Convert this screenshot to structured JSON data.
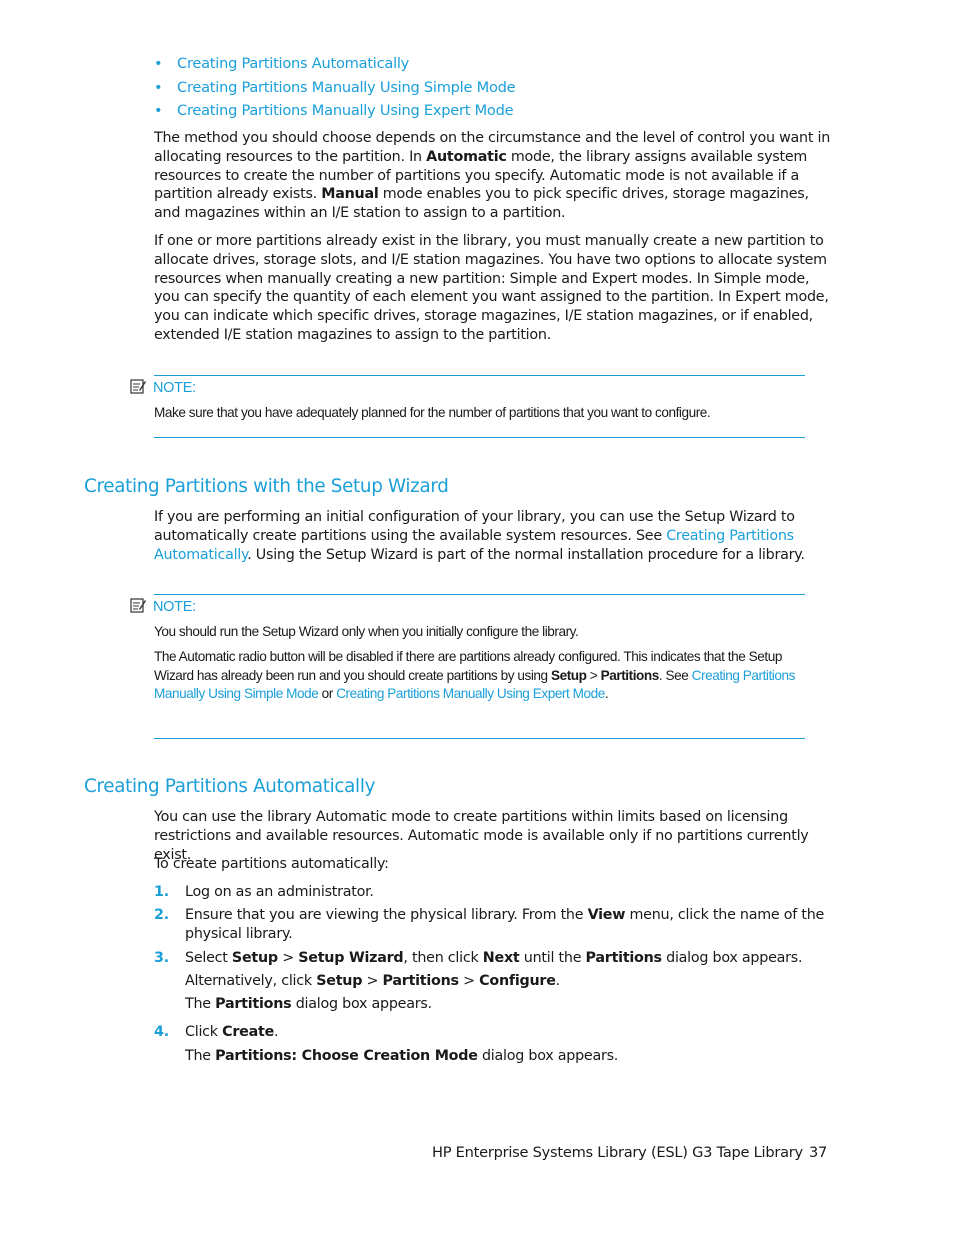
{
  "bullets": [
    "Creating Partitions Automatically",
    "Creating Partitions Manually Using Simple Mode",
    "Creating Partitions Manually Using Expert Mode"
  ],
  "intro_para1": {
    "t1": "The method you should choose depends on the circumstance and the level of control you want in allocating resources to the partition. In ",
    "b1": "Automatic",
    "t2": " mode, the library assigns available system resources to create the number of partitions you specify. Automatic mode is not available if a partition already exists. ",
    "b2": "Manual",
    "t3": " mode enables you to pick specific drives, storage magazines, and magazines within an I/E station to assign to a partition."
  },
  "intro_para2": "If one or more partitions already exist in the library, you must manually create a new partition to allocate drives, storage slots, and I/E station magazines. You have two options to allocate system resources when manually creating a new partition: Simple and Expert modes. In Simple mode, you can specify the quantity of each element you want assigned to the partition. In Expert mode, you can indicate which specific drives, storage magazines, I/E station magazines, or if enabled, extended I/E station magazines to assign to the partition.",
  "note1": {
    "label": "NOTE:",
    "text": "Make sure that you have adequately planned for the number of partitions that you want to configure."
  },
  "section_wizard": {
    "heading": "Creating Partitions with the Setup Wizard",
    "t1": "If you are performing an initial configuration of your library, you can use the Setup Wizard to automatically create partitions using the available system resources. See ",
    "link": "Creating Partitions Automatically",
    "t2": ". Using the Setup Wizard is part of the normal installation procedure for a library."
  },
  "note2": {
    "label": "NOTE:",
    "text1": "You should run the Setup Wizard only when you initially configure the library.",
    "t1": "The Automatic radio button will be disabled if there are partitions already configured. This indicates that the Setup Wizard has already been run and you should create partitions by using ",
    "b1": "Setup",
    "t2": " > ",
    "b2": "Partitions",
    "t3": ". See ",
    "link1": "Creating Partitions Manually Using Simple Mode",
    "t4": " or ",
    "link2": "Creating Partitions Manually Using Expert Mode",
    "t5": "."
  },
  "section_auto": {
    "heading": "Creating Partitions Automatically",
    "para1": "You can use the library Automatic mode to create partitions within limits based on licensing restrictions and available resources. Automatic mode is available only if no partitions currently exist.",
    "para2": "To create partitions automatically:",
    "steps": [
      {
        "num": "1.",
        "text": "Log on as an administrator."
      },
      {
        "num": "2.",
        "t1": "Ensure that you are viewing the physical library. From the ",
        "b1": "View",
        "t2": " menu, click the name of the physical library."
      },
      {
        "num": "3.",
        "t1": "Select ",
        "b1": "Setup",
        "t2": " > ",
        "b2": "Setup Wizard",
        "t3": ", then click ",
        "b3": "Next",
        "t4": " until the ",
        "b4": "Partitions",
        "t5": " dialog box appears.",
        "alt_t1": "Alternatively, click ",
        "alt_b1": "Setup",
        "alt_t2": " > ",
        "alt_b2": "Partitions",
        "alt_t3": " > ",
        "alt_b3": "Configure",
        "alt_t4": ".",
        "res_t1": "The ",
        "res_b1": "Partitions",
        "res_t2": " dialog box appears."
      },
      {
        "num": "4.",
        "t1": "Click ",
        "b1": "Create",
        "t2": ".",
        "res_t1": "The ",
        "res_b1": "Partitions: Choose Creation Mode",
        "res_t2": " dialog box appears."
      }
    ]
  },
  "footer": {
    "title": "HP Enterprise Systems Library (ESL) G3 Tape Library",
    "page_number": "37"
  },
  "colors": {
    "accent": "#1a9fd9",
    "text": "#1a1a1a"
  }
}
